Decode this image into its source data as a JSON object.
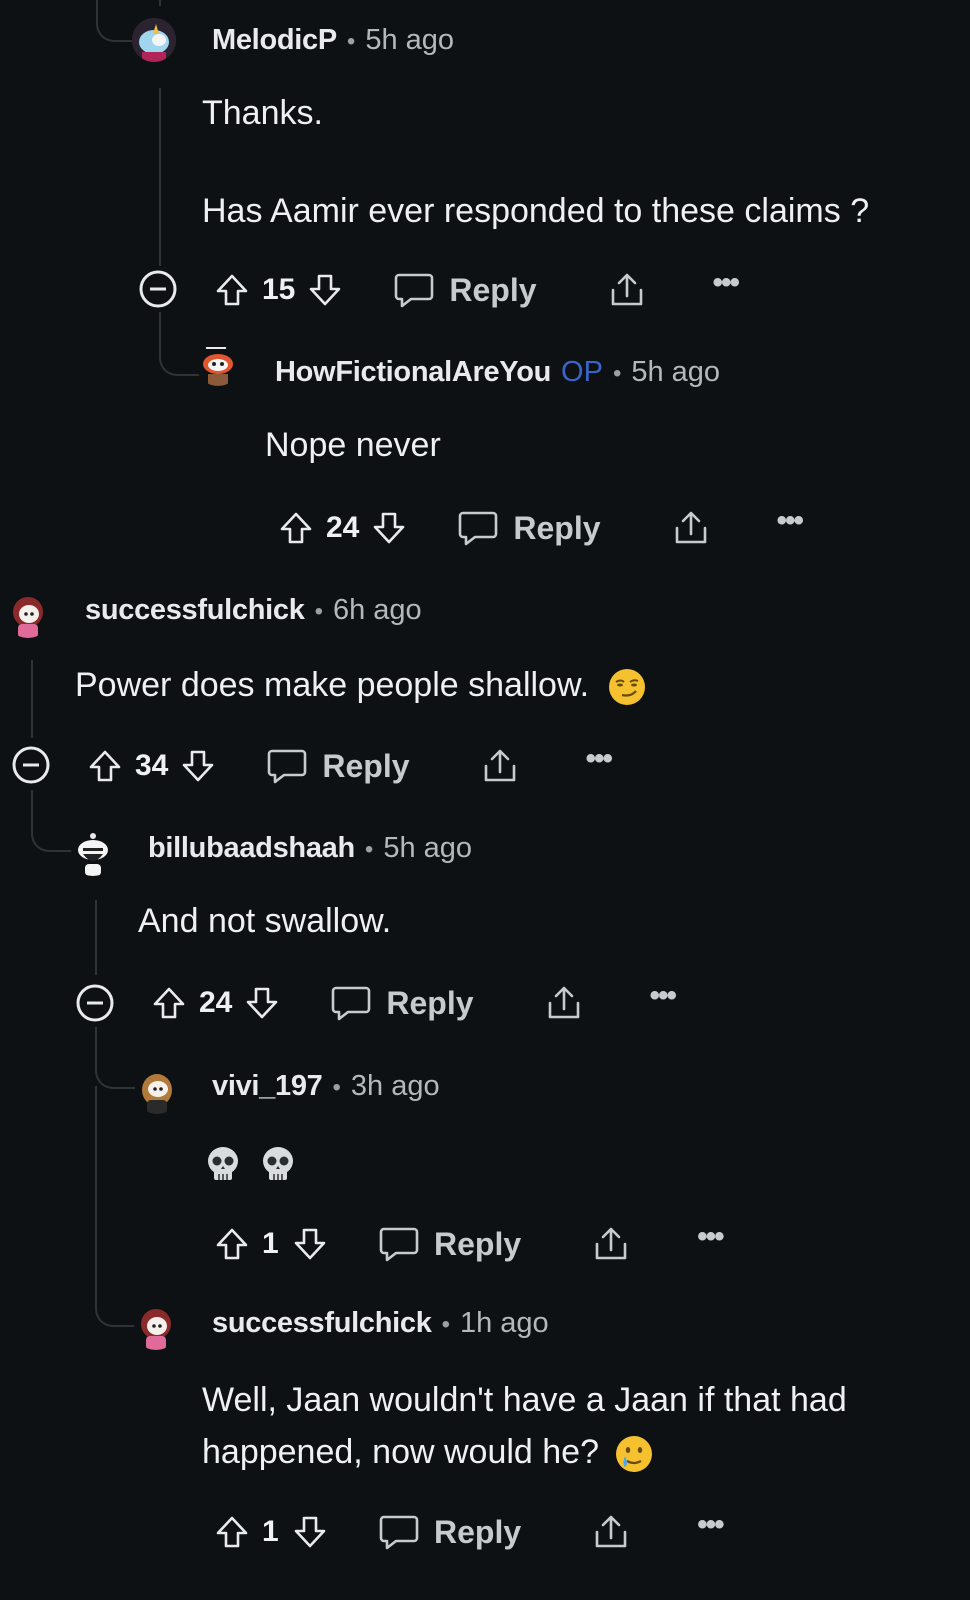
{
  "comments": [
    {
      "username": "MelodicP",
      "op": "",
      "time": "5h ago",
      "lines": [
        "Thanks.",
        "",
        "Has Aamir ever responded to these claims ?"
      ],
      "score": "15",
      "reply_label": "Reply",
      "avatar": "unicorn-avatar-icon"
    },
    {
      "username": "HowFictionalAreYou",
      "op": "OP",
      "time": "5h ago",
      "lines": [
        "Nope never"
      ],
      "score": "24",
      "reply_label": "Reply",
      "avatar": "snoo-avatar-icon"
    },
    {
      "username": "successfulchick",
      "op": "",
      "time": "6h ago",
      "lines": [
        "Power does make people shallow."
      ],
      "score": "34",
      "reply_label": "Reply",
      "emoji": "smirk-emoji",
      "avatar": "girl-avatar-icon"
    },
    {
      "username": "billubaadshaah",
      "op": "",
      "time": "5h ago",
      "lines": [
        "And not swallow."
      ],
      "score": "24",
      "reply_label": "Reply",
      "avatar": "bearded-snoo-avatar-icon"
    },
    {
      "username": "vivi_197",
      "op": "",
      "time": "3h ago",
      "lines": [],
      "score": "1",
      "reply_label": "Reply",
      "emoji": "skull-emoji x2",
      "avatar": "girl-avatar-icon"
    },
    {
      "username": "successfulchick",
      "op": "",
      "time": "1h ago",
      "lines": [
        "Well, Jaan wouldn't have a Jaan if that had",
        "happened, now would he?"
      ],
      "score": "1",
      "reply_label": "Reply",
      "emoji": "tear-smile-emoji",
      "avatar": "girl-avatar-icon"
    }
  ],
  "separator": "•",
  "more_label": "•••",
  "colors": {
    "background": "#0e1114",
    "op": "#3a64c9",
    "thread_line": "#2f3337",
    "text": "#e8eaed"
  }
}
